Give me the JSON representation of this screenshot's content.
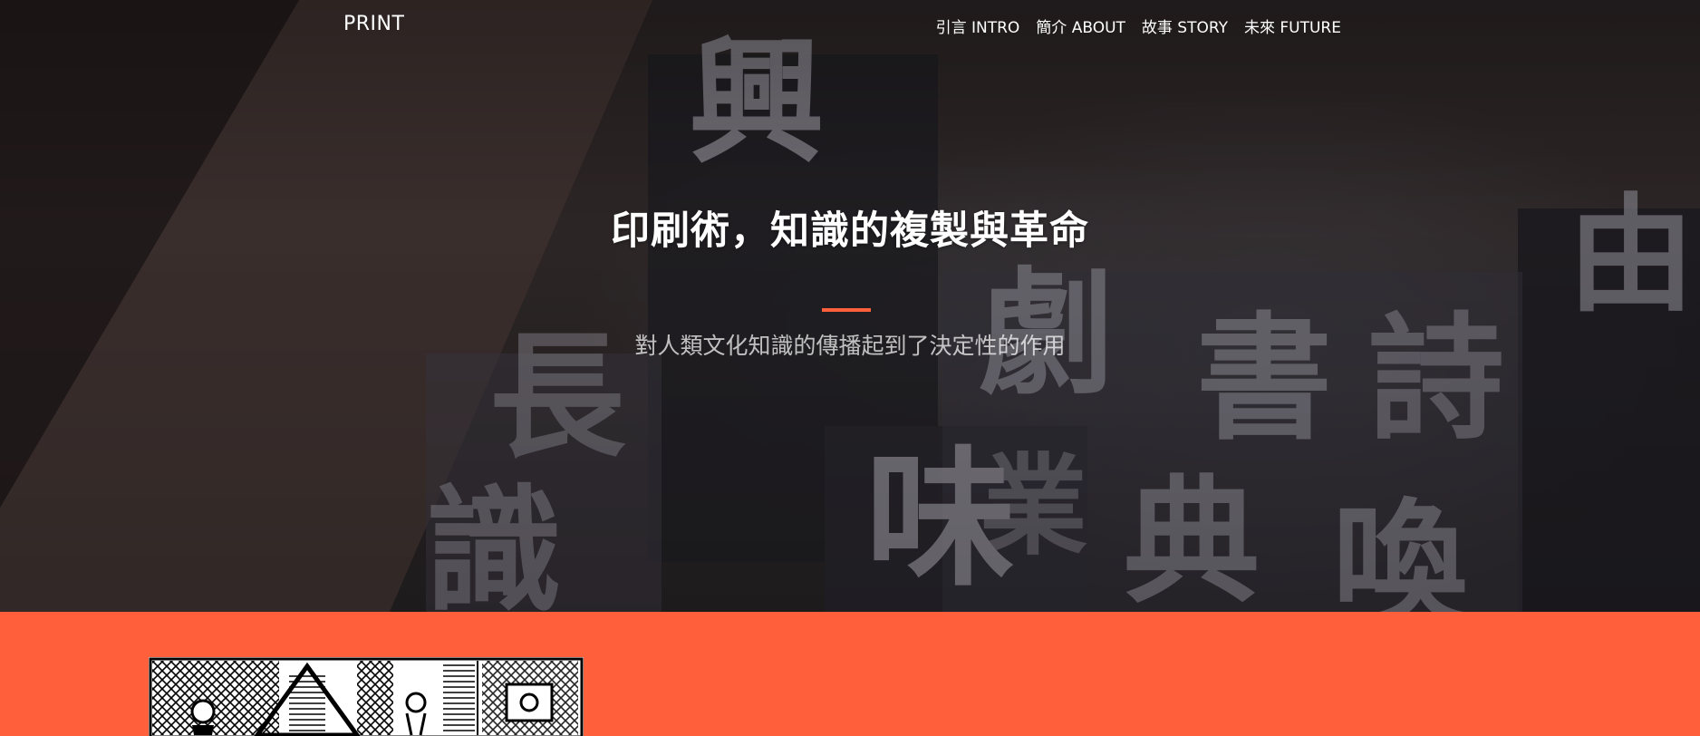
{
  "nav": {
    "brand": "PRINT",
    "links": [
      {
        "label": "引言 INTRO"
      },
      {
        "label": "簡介 ABOUT"
      },
      {
        "label": "故事 STORY"
      },
      {
        "label": "未來 FUTURE"
      }
    ]
  },
  "hero": {
    "title": "印刷術，知識的複製與革命",
    "subtitle": "對人類文化知識的傳播起到了決定性的作用",
    "type_glyphs": [
      "興",
      "味",
      "劇",
      "書",
      "詩",
      "典",
      "喚",
      "由",
      "長",
      "識",
      "業"
    ]
  },
  "colors": {
    "accent": "#ff5f3a",
    "hero_dark": "#2a2324",
    "text_light": "#ffffff"
  }
}
